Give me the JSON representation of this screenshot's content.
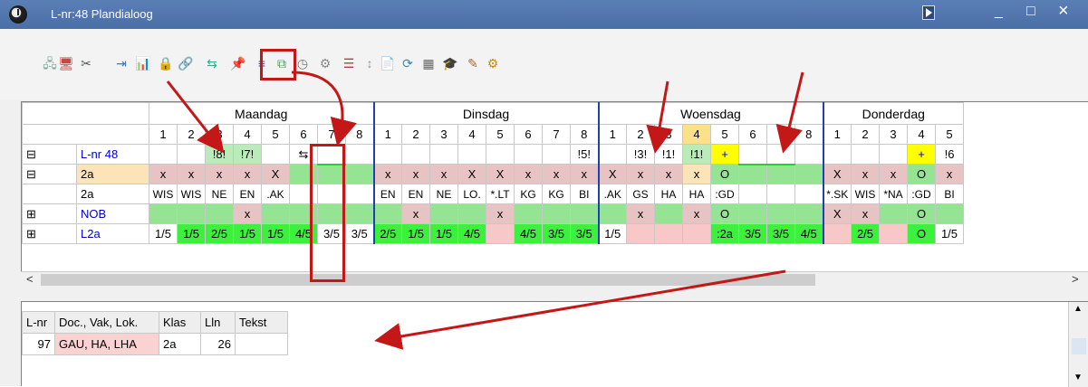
{
  "window": {
    "title": "L-nr:48  Plandialoog",
    "controls": {
      "minimize": "_",
      "maximize": "□",
      "close": "×"
    }
  },
  "toolbar": {
    "icons": [
      "connect-icon",
      "disconnect-icon",
      "cut-icon",
      "import-icon",
      "chart-icon",
      "lock-icon",
      "link-icon",
      "transfer-icon",
      "pin-icon",
      "filter-icon",
      "copy-icon",
      "clock-icon",
      "settings-icon",
      "list-icon",
      "sort-icon",
      "doc-icon",
      "refresh-icon",
      "calculator-icon",
      "grad-cap-icon",
      "paint-icon",
      "gear-icon"
    ]
  },
  "grid": {
    "days": [
      "Maandag",
      "Dinsdag",
      "Woensdag",
      "Donderdag"
    ],
    "periods": [
      "1",
      "2",
      "3",
      "4",
      "5",
      "6",
      "7",
      "8",
      "1",
      "2",
      "3",
      "4",
      "5",
      "6",
      "7",
      "8",
      "1",
      "2",
      "3",
      "4",
      "5",
      "6",
      "7",
      "8",
      "1",
      "2",
      "3",
      "4",
      "5"
    ],
    "rows": [
      {
        "expander": "⊟",
        "label": "L-nr 48",
        "kind": "lnr",
        "cells": [
          "",
          "",
          "!8!",
          "!7!",
          "",
          "⇆",
          "",
          "",
          "",
          "",
          "",
          "",
          "",
          "",
          "",
          "!5!",
          "",
          "!3!",
          "!1!",
          "!1!",
          "+",
          "",
          "",
          "",
          "",
          "",
          "",
          "+",
          "!6"
        ]
      },
      {
        "expander": "⊟",
        "label": "2a",
        "kind": "class",
        "cells": [
          "x",
          "x",
          "x",
          "x",
          "X",
          "",
          "",
          "",
          "x",
          "x",
          "x",
          "X",
          "X",
          "x",
          "x",
          "x",
          "X",
          "x",
          "x",
          "x",
          "O",
          "",
          "",
          "",
          "X",
          "x",
          "x",
          "O",
          "x"
        ]
      },
      {
        "expander": "",
        "label": "2a",
        "kind": "plain",
        "cells": [
          "WIS",
          "WIS",
          "NE",
          "EN",
          ".AK",
          "",
          "",
          "",
          "EN",
          "EN",
          "NE",
          "LO.",
          "*.LT",
          "KG",
          "KG",
          "BI",
          ".AK",
          "GS",
          "HA",
          "HA",
          ":GD",
          "",
          "",
          "",
          "*.SK",
          "WIS",
          "*NA",
          ":GD",
          "BI"
        ]
      },
      {
        "expander": "⊞",
        "label": "NOB",
        "kind": "room",
        "cells": [
          "",
          "",
          "",
          "x",
          "",
          "",
          "",
          "",
          "",
          "x",
          "",
          "",
          "x",
          "",
          "",
          "",
          "",
          "x",
          "",
          "x",
          "O",
          "",
          "",
          "",
          "X",
          "x",
          "",
          "O",
          ""
        ]
      },
      {
        "expander": "⊞",
        "label": "L2a",
        "kind": "l2a",
        "cells": [
          "1/5",
          "1/5",
          "2/5",
          "1/5",
          "1/5",
          "4/5",
          "3/5",
          "3/5",
          "2/5",
          "1/5",
          "1/5",
          "4/5",
          "",
          "4/5",
          "3/5",
          "3/5",
          "1/5",
          "",
          "",
          "",
          ":2a",
          "3/5",
          "3/5",
          "4/5",
          "",
          "2/5",
          "",
          "O",
          "1/5"
        ]
      }
    ]
  },
  "bottom_table": {
    "headers": [
      "L-nr",
      "Doc., Vak, Lok.",
      "Klas",
      "Lln",
      "Tekst"
    ],
    "row": [
      "97",
      "GAU, HA, LHA",
      "2a",
      "26",
      ""
    ]
  }
}
